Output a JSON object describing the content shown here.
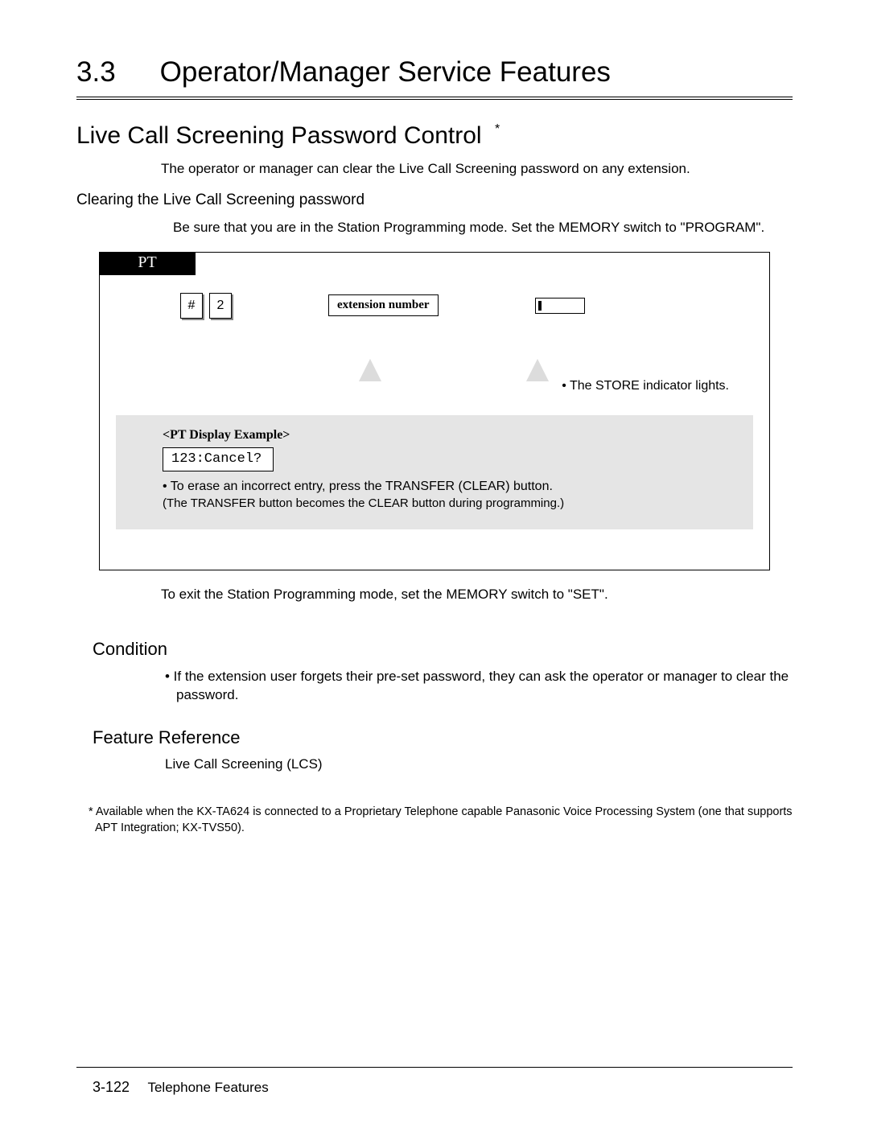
{
  "header": {
    "section_number": "3.3",
    "section_title": "Operator/Manager Service Features"
  },
  "topic": {
    "title": "Live Call Screening Password Control",
    "footnote_mark": "*",
    "intro": "The operator or manager can clear the Live Call Screening password on any extension.",
    "sub_action": "Clearing the Live Call Screening password",
    "instruction": "Be sure that you are in the Station Programming mode. Set the MEMORY switch to \"PROGRAM\"."
  },
  "procedure": {
    "tab": "PT",
    "keys": [
      "#",
      "2"
    ],
    "ext_label": "extension number",
    "store_note": "• The STORE indicator lights.",
    "display_label": "<PT Display Example>",
    "display_text": "123:Cancel?",
    "erase_note": "• To erase an incorrect entry, press the TRANSFER (CLEAR) button.",
    "erase_sub": "(The TRANSFER button becomes the CLEAR button during programming.)"
  },
  "exit_text": "To exit the Station Programming mode, set the MEMORY switch to \"SET\".",
  "condition": {
    "title": "Condition",
    "body": "• If the extension user forgets their pre-set password, they can ask the operator or manager to clear the password."
  },
  "feature_ref": {
    "title": "Feature Reference",
    "body": "Live Call Screening (LCS)"
  },
  "footnote": "* Available when the KX-TA624 is connected to a Proprietary Telephone capable Panasonic Voice Processing System (one that supports APT Integration; KX-TVS50).",
  "footer": {
    "page": "3-122",
    "label": "Telephone Features"
  }
}
